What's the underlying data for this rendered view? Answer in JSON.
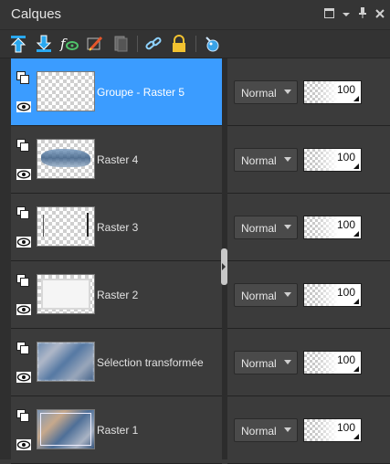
{
  "panel": {
    "title": "Calques",
    "controls": [
      "restore-icon",
      "dropdown-icon",
      "pin-icon",
      "close-icon"
    ]
  },
  "toolbar": {
    "tools": [
      "move-layer-up-icon",
      "move-layer-down-icon",
      "effects-fx-icon",
      "edit-layer-icon",
      "mask-icon",
      "link-icon",
      "lock-icon",
      "highlight-icon"
    ]
  },
  "layers": [
    {
      "name": "Groupe - Raster 5",
      "blend": "Normal",
      "opacity": "100",
      "selected": true
    },
    {
      "name": "Raster 4",
      "blend": "Normal",
      "opacity": "100",
      "selected": false
    },
    {
      "name": "Raster 3",
      "blend": "Normal",
      "opacity": "100",
      "selected": false
    },
    {
      "name": "Raster 2",
      "blend": "Normal",
      "opacity": "100",
      "selected": false
    },
    {
      "name": "Sélection transformée",
      "blend": "Normal",
      "opacity": "100",
      "selected": false
    },
    {
      "name": "Raster 1",
      "blend": "Normal",
      "opacity": "100",
      "selected": false
    }
  ],
  "colors": {
    "selection": "#3b9cff",
    "panel": "#3b3b3b",
    "background": "#2c2c2c"
  }
}
